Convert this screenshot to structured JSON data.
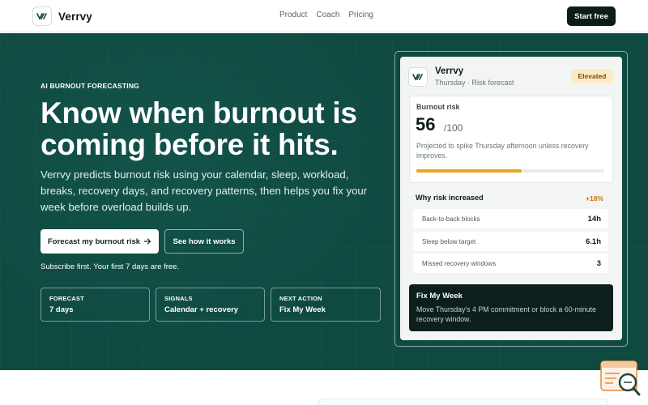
{
  "nav": {
    "brand": "Verrvy",
    "links": [
      "Product",
      "Coach",
      "Pricing"
    ],
    "cta": "Start free"
  },
  "hero": {
    "eyebrow": "AI BURNOUT FORECASTING",
    "headline": "Know when burnout is coming before it hits.",
    "subcopy": "Verrvy predicts burnout risk using your calendar, sleep, workload, breaks, recovery days, and recovery patterns, then helps you fix your week before overload builds up.",
    "primary_cta": "Forecast my burnout risk",
    "secondary_cta": "See how it works",
    "note": "Subscribe first. Your first 7 days are free.",
    "stats": [
      {
        "label": "FORECAST",
        "value": "7 days"
      },
      {
        "label": "SIGNALS",
        "value": "Calendar + recovery"
      },
      {
        "label": "NEXT ACTION",
        "value": "Fix My Week"
      }
    ]
  },
  "card": {
    "title": "Verrvy",
    "subtitle": "Thursday · Risk forecast",
    "badge": "Elevated",
    "risk_label": "Burnout risk",
    "risk_score": "56",
    "risk_max": "/100",
    "risk_desc": "Projected to spike Thursday afternoon unless recovery improves.",
    "risk_progress": 0.56,
    "why_title": "Why risk increased",
    "why_delta": "+18%",
    "drivers": [
      {
        "label": "Back-to-back blocks",
        "value": "14h"
      },
      {
        "label": "Sleep below target",
        "value": "6.1h"
      },
      {
        "label": "Missed recovery windows",
        "value": "3"
      }
    ],
    "fix_title": "Fix My Week",
    "fix_body": "Move Thursday's 4 PM commitment or block a 60-minute recovery window."
  },
  "colors": {
    "hero_bg": "#0f4a41",
    "accent_amber": "#eda51a",
    "dark": "#0d1b19"
  }
}
